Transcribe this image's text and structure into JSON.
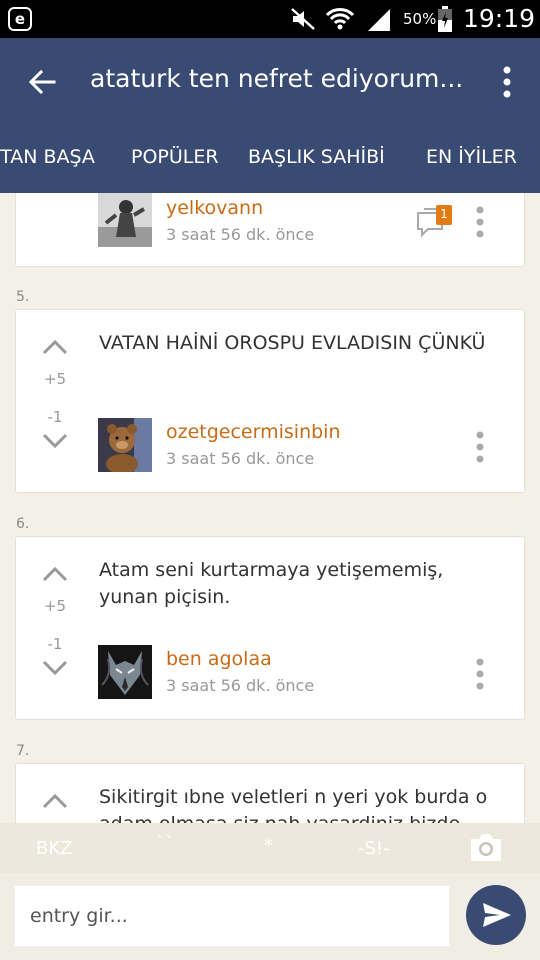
{
  "status_bar": {
    "app_letter": "e",
    "battery_percent": "50%",
    "time": "19:19"
  },
  "app_bar": {
    "title": "ataturk ten nefret ediyorum..."
  },
  "tabs": [
    {
      "label": "BAŞTAN BAŞA",
      "selected": true
    },
    {
      "label": "POPÜLER"
    },
    {
      "label": "BAŞLIK SAHİBİ"
    },
    {
      "label": "EN İYİLER"
    }
  ],
  "entries": [
    {
      "author": "yelkovann",
      "time": "3 saat 56 dk. önce",
      "comment_count": "1"
    },
    {
      "number": "5.",
      "text": "VATAN HAİNİ OROSPU EVLADISIN ÇÜNKÜ",
      "upvotes": "+5",
      "downvotes": "-1",
      "author": "ozetgecermisinbin",
      "time": "3 saat 56 dk. önce"
    },
    {
      "number": "6.",
      "text": "Atam seni kurtarmaya yetişememiş, yunan piçisin.",
      "upvotes": "+5",
      "downvotes": "-1",
      "author": "ben agolaa",
      "time": "3 saat 56 dk. önce"
    },
    {
      "number": "7.",
      "text": "Sikitirgit ıbne veletleri n yeri yok burda o adam olmasa siz nah yasardiniz bizde"
    }
  ],
  "format_toolbar": {
    "bkz": "BKZ",
    "backtick": "``",
    "asterisk": "*",
    "spoiler": "-S!-"
  },
  "input": {
    "placeholder": "entry gir..."
  },
  "colors": {
    "app_bar": "#3a4b73",
    "author": "#c96b16",
    "badge": "#e07b16",
    "background": "#f3f0e7"
  }
}
